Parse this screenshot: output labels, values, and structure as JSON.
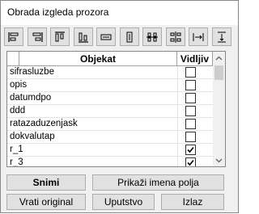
{
  "window": {
    "title": "Obrada izgleda prozora"
  },
  "toolbar": {
    "buttons": [
      {
        "name": "align-left-icon"
      },
      {
        "name": "align-right-icon"
      },
      {
        "name": "align-top-icon"
      },
      {
        "name": "align-bottom-icon"
      },
      {
        "name": "same-width-icon"
      },
      {
        "name": "same-height-icon"
      },
      {
        "name": "horizontal-spacing-icon"
      },
      {
        "name": "vertical-spacing-icon"
      },
      {
        "name": "center-horizontally-icon"
      },
      {
        "name": "center-vertically-icon"
      }
    ]
  },
  "grid": {
    "col_object": "Objekat",
    "col_visible": "Vidljiv",
    "rows": [
      {
        "name": "sifrasluzbe",
        "visible": false
      },
      {
        "name": "opis",
        "visible": false
      },
      {
        "name": "datumdpo",
        "visible": false
      },
      {
        "name": "ddd",
        "visible": false
      },
      {
        "name": "ratazaduzenjask",
        "visible": false
      },
      {
        "name": "dokvalutap",
        "visible": false
      },
      {
        "name": "r_1",
        "visible": true
      },
      {
        "name": "r_3",
        "visible": true
      }
    ]
  },
  "buttons": {
    "save": "Snimi",
    "show_field_names": "Prikaži imena polja",
    "restore_original": "Vrati original",
    "instructions": "Uputstvo",
    "exit": "Izlaz"
  },
  "colors": {
    "border": "#adadad",
    "button_bg": "#e1e1e1",
    "window_bg": "#f0f0f0"
  }
}
